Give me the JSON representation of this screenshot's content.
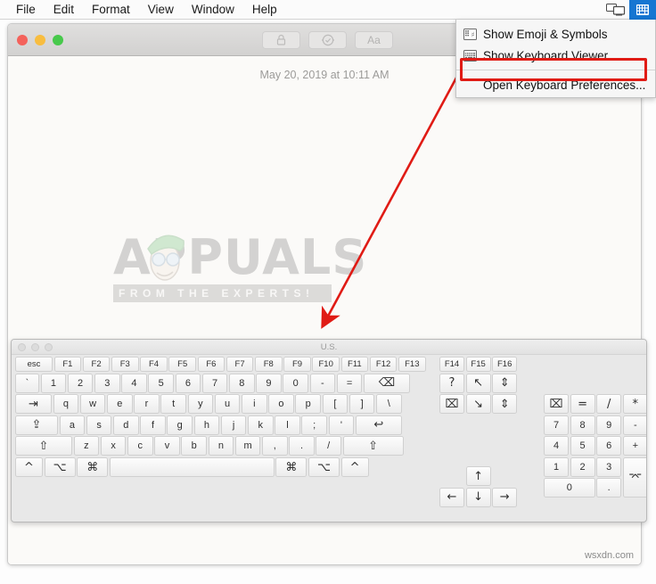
{
  "menubar": {
    "items": [
      "File",
      "Edit",
      "Format",
      "View",
      "Window",
      "Help"
    ],
    "display_icon": "screens-icon",
    "input_menu_icon": "keyboard-input-menu-icon"
  },
  "dropdown": {
    "items": [
      {
        "label": "Show Emoji & Symbols",
        "icon": "emoji-symbols-icon",
        "highlighted": false
      },
      {
        "label": "Show Keyboard Viewer",
        "icon": "keyboard-viewer-icon",
        "highlighted": true
      },
      {
        "label": "Open Keyboard Preferences...",
        "icon": "none",
        "highlighted": false
      }
    ],
    "highlight_color": "#e01b15"
  },
  "document_window": {
    "title_tools": [
      {
        "label": "\u0001",
        "icon": "lock-icon"
      },
      {
        "label": "\u0001",
        "icon": "check-circle-icon"
      },
      {
        "label": "Aa",
        "icon": "font-icon"
      }
    ],
    "date_text": "May 20, 2019 at 10:11 AM",
    "watermark_word": "APPUALS",
    "watermark_tagline": "FROM THE EXPERTS!",
    "corner_watermark": "wsxdn.com"
  },
  "keyboard_viewer": {
    "title": "U.S.",
    "rows": {
      "function_row": [
        "esc",
        "F1",
        "F2",
        "F3",
        "F4",
        "F5",
        "F6",
        "F7",
        "F8",
        "F9",
        "F10",
        "F11",
        "F12",
        "F13"
      ],
      "number_row": [
        "`",
        "1",
        "2",
        "3",
        "4",
        "5",
        "6",
        "7",
        "8",
        "9",
        "0",
        "-",
        "=",
        "⌫"
      ],
      "qwerty_row": [
        "⇥",
        "q",
        "w",
        "e",
        "r",
        "t",
        "y",
        "u",
        "i",
        "o",
        "p",
        "[",
        "]",
        "\\"
      ],
      "home_row": [
        "⇪",
        "a",
        "s",
        "d",
        "f",
        "g",
        "h",
        "j",
        "k",
        "l",
        ";",
        "'",
        "↩"
      ],
      "shift_row": [
        "⇧",
        "z",
        "x",
        "c",
        "v",
        "b",
        "n",
        "m",
        ",",
        ".",
        "/",
        "⇧"
      ],
      "modifier_row": [
        "^",
        "⌥",
        "⌘",
        "",
        "⌘",
        "⌥",
        "^"
      ]
    },
    "nav_cluster": {
      "fn_row": [
        "F14",
        "F15",
        "F16"
      ],
      "row1": [
        "?",
        "↖",
        "⇕"
      ],
      "row2": [
        "⌧",
        "↘",
        "⇕"
      ],
      "arrows": {
        "up": "↑",
        "left": "←",
        "down": "↓",
        "right": "→"
      }
    },
    "numpad": {
      "row0": [
        "⌧",
        "=",
        "/",
        "*"
      ],
      "row1": [
        "7",
        "8",
        "9",
        "-"
      ],
      "row2": [
        "4",
        "5",
        "6",
        "+"
      ],
      "row3": [
        "1",
        "2",
        "3"
      ],
      "row4": [
        "0",
        "."
      ],
      "enter": "⌤"
    }
  }
}
